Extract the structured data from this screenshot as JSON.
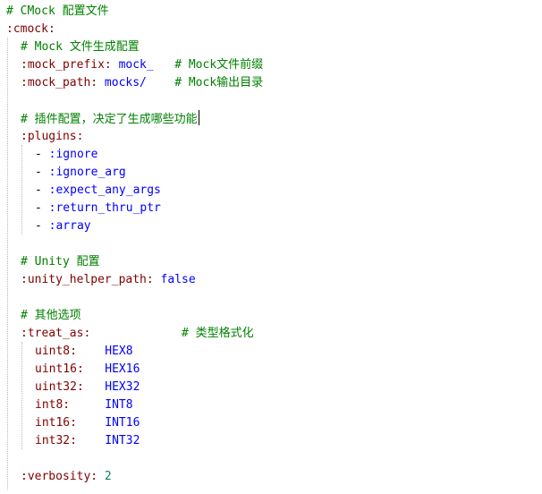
{
  "editor": {
    "lines": [
      {
        "n": 1,
        "indent": 0,
        "parts": [
          {
            "t": "# CMock 配置文件",
            "c": "comment"
          }
        ]
      },
      {
        "n": 2,
        "indent": 0,
        "parts": [
          {
            "t": ":cmock:",
            "c": "key"
          }
        ]
      },
      {
        "n": 3,
        "indent": 2,
        "parts": [
          {
            "t": "# Mock 文件生成配置",
            "c": "comment"
          }
        ]
      },
      {
        "n": 4,
        "indent": 2,
        "parts": [
          {
            "t": ":mock_prefix:",
            "c": "key"
          },
          {
            "t": " mock_",
            "c": "value"
          },
          {
            "t": "   # Mock文件前缀",
            "c": "comment"
          }
        ]
      },
      {
        "n": 5,
        "indent": 2,
        "parts": [
          {
            "t": ":mock_path:",
            "c": "key"
          },
          {
            "t": " mocks/",
            "c": "value"
          },
          {
            "t": "    # Mock输出目录",
            "c": "comment"
          }
        ]
      },
      {
        "n": 6,
        "indent": 0,
        "parts": []
      },
      {
        "n": 7,
        "indent": 2,
        "parts": [
          {
            "t": "# 插件配置，决定了生成哪些功能",
            "c": "comment"
          }
        ],
        "caret": true
      },
      {
        "n": 8,
        "indent": 2,
        "parts": [
          {
            "t": ":plugins:",
            "c": "key"
          }
        ]
      },
      {
        "n": 9,
        "indent": 4,
        "parts": [
          {
            "t": "- ",
            "c": "dash"
          },
          {
            "t": ":ignore",
            "c": "value"
          }
        ]
      },
      {
        "n": 10,
        "indent": 4,
        "parts": [
          {
            "t": "- ",
            "c": "dash"
          },
          {
            "t": ":ignore_arg",
            "c": "value"
          }
        ]
      },
      {
        "n": 11,
        "indent": 4,
        "parts": [
          {
            "t": "- ",
            "c": "dash"
          },
          {
            "t": ":expect_any_args",
            "c": "value"
          }
        ]
      },
      {
        "n": 12,
        "indent": 4,
        "parts": [
          {
            "t": "- ",
            "c": "dash"
          },
          {
            "t": ":return_thru_ptr",
            "c": "value"
          }
        ]
      },
      {
        "n": 13,
        "indent": 4,
        "parts": [
          {
            "t": "- ",
            "c": "dash"
          },
          {
            "t": ":array",
            "c": "value"
          }
        ]
      },
      {
        "n": 14,
        "indent": 0,
        "parts": []
      },
      {
        "n": 15,
        "indent": 2,
        "parts": [
          {
            "t": "# Unity 配置",
            "c": "comment"
          }
        ]
      },
      {
        "n": 16,
        "indent": 2,
        "parts": [
          {
            "t": ":unity_helper_path:",
            "c": "key"
          },
          {
            "t": " false",
            "c": "value"
          }
        ]
      },
      {
        "n": 17,
        "indent": 0,
        "parts": []
      },
      {
        "n": 18,
        "indent": 2,
        "parts": [
          {
            "t": "# 其他选项",
            "c": "comment"
          }
        ]
      },
      {
        "n": 19,
        "indent": 2,
        "parts": [
          {
            "t": ":treat_as:",
            "c": "key"
          },
          {
            "t": "             # 类型格式化",
            "c": "comment"
          }
        ]
      },
      {
        "n": 20,
        "indent": 4,
        "parts": [
          {
            "t": "uint8:",
            "c": "key"
          },
          {
            "t": "    HEX8",
            "c": "value"
          }
        ]
      },
      {
        "n": 21,
        "indent": 4,
        "parts": [
          {
            "t": "uint16:",
            "c": "key"
          },
          {
            "t": "   HEX16",
            "c": "value"
          }
        ]
      },
      {
        "n": 22,
        "indent": 4,
        "parts": [
          {
            "t": "uint32:",
            "c": "key"
          },
          {
            "t": "   HEX32",
            "c": "value"
          }
        ]
      },
      {
        "n": 23,
        "indent": 4,
        "parts": [
          {
            "t": "int8:",
            "c": "key"
          },
          {
            "t": "     INT8",
            "c": "value"
          }
        ]
      },
      {
        "n": 24,
        "indent": 4,
        "parts": [
          {
            "t": "int16:",
            "c": "key"
          },
          {
            "t": "    INT16",
            "c": "value"
          }
        ]
      },
      {
        "n": 25,
        "indent": 4,
        "parts": [
          {
            "t": "int32:",
            "c": "key"
          },
          {
            "t": "    INT32",
            "c": "value"
          }
        ]
      },
      {
        "n": 26,
        "indent": 0,
        "parts": []
      },
      {
        "n": 27,
        "indent": 2,
        "parts": [
          {
            "t": ":verbosity:",
            "c": "key"
          },
          {
            "t": " 2",
            "c": "number"
          }
        ]
      }
    ],
    "colors": {
      "comment": "#008000",
      "key": "#800000",
      "value": "#0000ff",
      "number": "#098658",
      "background": "#ffffff"
    }
  }
}
